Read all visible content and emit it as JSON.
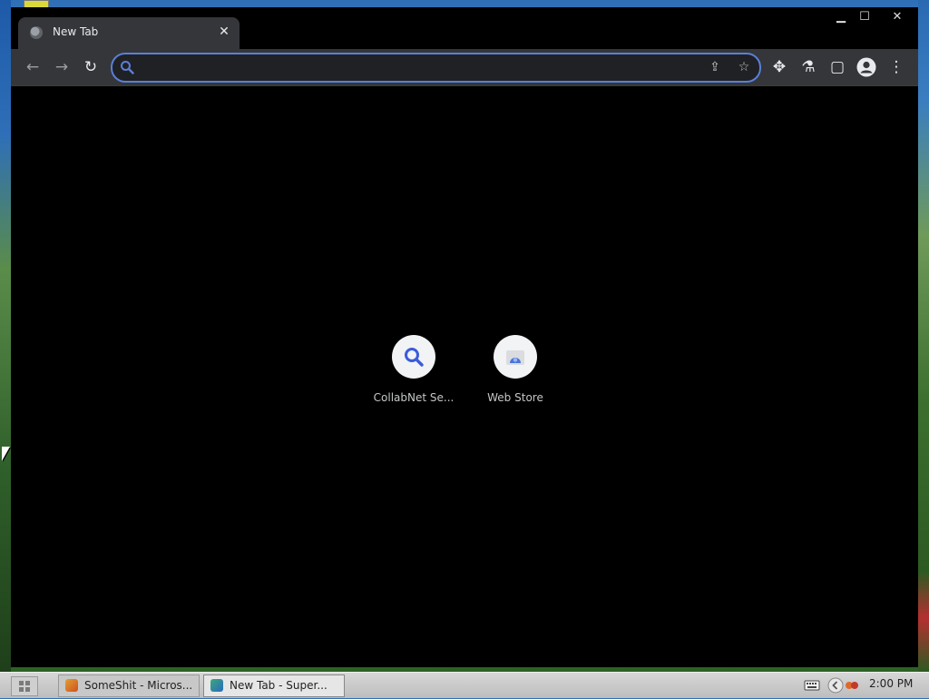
{
  "browser": {
    "tab": {
      "title": "New Tab",
      "close": "✕"
    },
    "window_controls": {
      "minimize": "▁",
      "maximize": "☐",
      "close": "✕"
    },
    "toolbar": {
      "back": "←",
      "forward": "→",
      "reload": "↻",
      "omnibox": {
        "value": "",
        "placeholder": ""
      },
      "share": "⇪",
      "bookmark": "☆",
      "extensions": "✥",
      "labs": "⚗",
      "side_panel": "▢",
      "menu": "⋮"
    },
    "accent": "#5a7fd8"
  },
  "new_tab_page": {
    "shortcuts": [
      {
        "title": "CollabNet Se...",
        "icon": "search-icon"
      },
      {
        "title": "Web Store",
        "icon": "web-store-icon"
      }
    ]
  },
  "taskbar": {
    "items": [
      {
        "label": "SomeShit - Micros...",
        "icon": "paint-icon"
      },
      {
        "label": "New Tab - Super...",
        "icon": "browser-icon"
      }
    ],
    "clock": "2:00 PM"
  }
}
